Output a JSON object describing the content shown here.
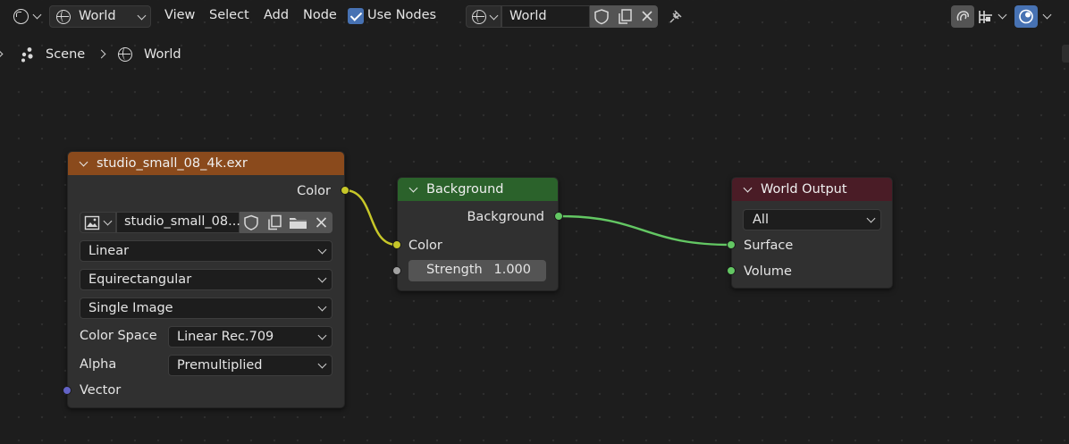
{
  "header": {
    "editor_type_icon": "node-editor-icon",
    "shader_type_icon": "world-globe-icon",
    "shader_type_label": "World",
    "menus": [
      "View",
      "Select",
      "Add",
      "Node"
    ],
    "use_nodes_label": "Use Nodes",
    "use_nodes_checked": true,
    "world_datablock_name": "World",
    "icons": [
      "fake-user-shield-icon",
      "duplicate-icon",
      "close-icon",
      "pin-icon",
      "overlay-icon",
      "snap-icon",
      "gizmo-icon"
    ]
  },
  "breadcrumb": {
    "scene_label": "Scene",
    "world_label": "World"
  },
  "nodes": {
    "image_texture": {
      "title": "studio_small_08_4k.exr",
      "header_color": "#8a4a1c",
      "output_color_label": "Color",
      "image_name": "studio_small_08...",
      "interpolation": "Linear",
      "projection": "Equirectangular",
      "source": "Single Image",
      "color_space_label": "Color Space",
      "color_space_value": "Linear Rec.709",
      "alpha_label": "Alpha",
      "alpha_value": "Premultiplied",
      "input_vector_label": "Vector"
    },
    "background": {
      "title": "Background",
      "header_color": "#2b622b",
      "output_label": "Background",
      "input_color_label": "Color",
      "strength_label": "Strength",
      "strength_value": "1.000"
    },
    "world_output": {
      "title": "World Output",
      "header_color": "#4a1c26",
      "target_value": "All",
      "surface_label": "Surface",
      "volume_label": "Volume"
    }
  },
  "colors": {
    "canvas": "#1d1d1d",
    "node_body": "#303030",
    "socket_color": "#c7c729",
    "socket_shader": "#63c763",
    "socket_float": "#a1a1a1",
    "socket_vector": "#6363c7",
    "accent": "#4772b3"
  }
}
